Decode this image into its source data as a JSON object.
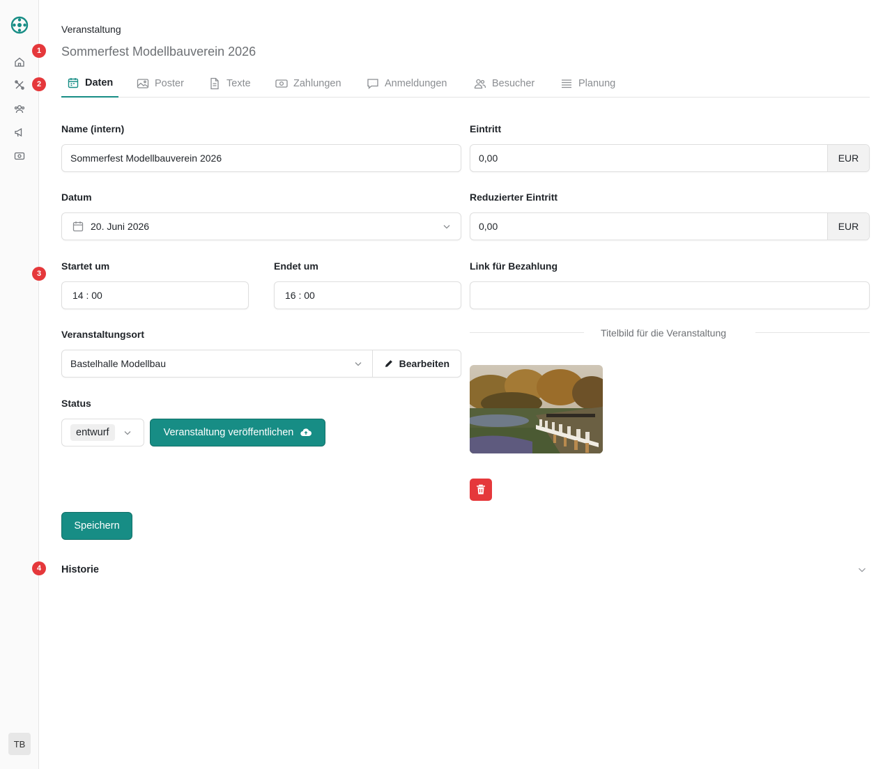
{
  "sidebar": {
    "logo": "app-logo",
    "nav": [
      {
        "icon": "home-icon"
      },
      {
        "icon": "tools-icon"
      },
      {
        "icon": "group-icon"
      },
      {
        "icon": "megaphone-icon"
      },
      {
        "icon": "ticket-icon"
      }
    ],
    "avatar": "TB"
  },
  "markers": [
    "1",
    "2",
    "3",
    "4"
  ],
  "header": {
    "eyebrow": "Veranstaltung",
    "title": "Sommerfest Modellbauverein 2026"
  },
  "tabs": [
    {
      "label": "Daten",
      "icon": "calendar-icon",
      "active": true
    },
    {
      "label": "Poster",
      "icon": "image-icon"
    },
    {
      "label": "Texte",
      "icon": "document-icon"
    },
    {
      "label": "Zahlungen",
      "icon": "cash-icon"
    },
    {
      "label": "Anmeldungen",
      "icon": "chat-icon"
    },
    {
      "label": "Besucher",
      "icon": "users-icon"
    },
    {
      "label": "Planung",
      "icon": "list-icon"
    }
  ],
  "form": {
    "name": {
      "label": "Name (intern)",
      "value": "Sommerfest Modellbauverein 2026"
    },
    "datum": {
      "label": "Datum",
      "value": "20. Juni 2026"
    },
    "start": {
      "label": "Startet um",
      "value": "14 : 00"
    },
    "end": {
      "label": "Endet um",
      "value": "16 : 00"
    },
    "venue": {
      "label": "Veranstaltungsort",
      "value": "Bastelhalle Modellbau",
      "edit_label": "Bearbeiten"
    },
    "status": {
      "label": "Status",
      "value": "entwurf",
      "publish_label": "Veranstaltung veröffentlichen"
    },
    "entry": {
      "label": "Eintritt",
      "value": "0,00",
      "currency": "EUR"
    },
    "reduced": {
      "label": "Reduzierter Eintritt",
      "value": "0,00",
      "currency": "EUR"
    },
    "payment_link": {
      "label": "Link für Bezahlung",
      "value": ""
    },
    "image_section": "Titelbild für die Veranstaltung",
    "save_label": "Speichern"
  },
  "history": {
    "label": "Historie"
  },
  "colors": {
    "accent": "#178d85",
    "danger": "#e5383b"
  }
}
